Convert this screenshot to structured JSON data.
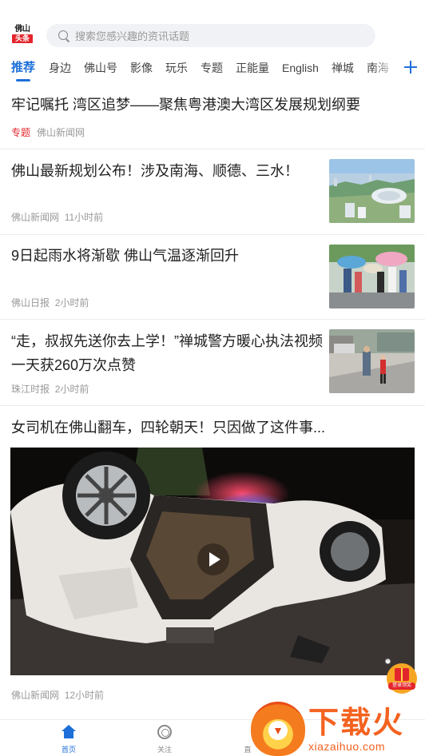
{
  "app": {
    "logo_top": "佛山",
    "logo_bottom": "头条"
  },
  "search": {
    "placeholder": "搜索您感兴趣的资讯话题"
  },
  "tabs": [
    {
      "label": "推荐",
      "active": true
    },
    {
      "label": "身边"
    },
    {
      "label": "佛山号"
    },
    {
      "label": "影像"
    },
    {
      "label": "玩乐"
    },
    {
      "label": "专题"
    },
    {
      "label": "正能量"
    },
    {
      "label": "English"
    },
    {
      "label": "禅城"
    },
    {
      "label": "南海"
    }
  ],
  "feed": {
    "top_story": {
      "title": "牢记嘱托 湾区追梦——聚焦粤港澳大湾区发展规划纲要",
      "tag": "专题",
      "source": "佛山新闻网"
    },
    "items": [
      {
        "title": "佛山最新规划公布！涉及南海、顺德、三水！",
        "source": "佛山新闻网",
        "time": "11小时前"
      },
      {
        "title": "9日起雨水将渐歇 佛山气温逐渐回升",
        "source": "佛山日报",
        "time": "2小时前"
      },
      {
        "title": "“走，叔叔先送你去上学！”禅城警方暖心执法视频一天获260万次点赞",
        "source": "珠江时报",
        "time": "2小时前"
      }
    ],
    "video_story": {
      "title": "女司机在佛山翻车，四轮朝天！只因做了这件事...",
      "source": "佛山新闻网",
      "time": "12小时前"
    }
  },
  "gift_badge": {
    "label": "登录领奖"
  },
  "bottom_nav": [
    {
      "label": "首页",
      "active": true
    },
    {
      "label": "关注"
    },
    {
      "label": "直"
    }
  ],
  "watermark": {
    "text": "下载火",
    "url": "xiazaihuo.com"
  },
  "colors": {
    "accent": "#1e6fd9",
    "tag_red": "#e3262c",
    "watermark": "#f46220"
  }
}
